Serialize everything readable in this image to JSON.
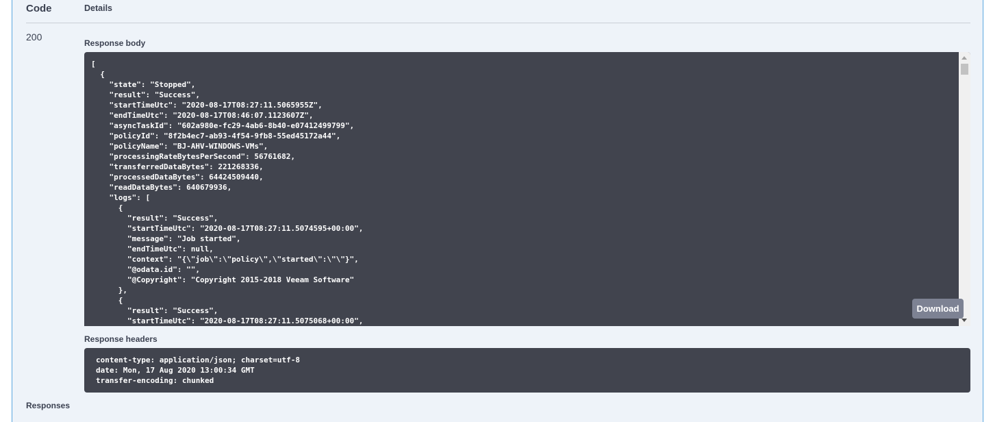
{
  "table": {
    "code_header": "Code",
    "details_header": "Details"
  },
  "response": {
    "status_code": "200",
    "body_label": "Response body",
    "body_lines": [
      "[",
      "  {",
      "    \"state\": \"Stopped\",",
      "    \"result\": \"Success\",",
      "    \"startTimeUtc\": \"2020-08-17T08:27:11.5065955Z\",",
      "    \"endTimeUtc\": \"2020-08-17T08:46:07.1123607Z\",",
      "    \"asyncTaskId\": \"602a980e-fc29-4ab6-8b40-e07412499799\",",
      "    \"policyId\": \"8f2b4ec7-ab93-4f54-9fb8-55ed45172a44\",",
      "    \"policyName\": \"BJ-AHV-WINDOWS-VMs\",",
      "    \"processingRateBytesPerSecond\": 56761682,",
      "    \"transferredDataBytes\": 221268336,",
      "    \"processedDataBytes\": 64424509440,",
      "    \"readDataBytes\": 640679936,",
      "    \"logs\": [",
      "      {",
      "        \"result\": \"Success\",",
      "        \"startTimeUtc\": \"2020-08-17T08:27:11.5074595+00:00\",",
      "        \"message\": \"Job started\",",
      "        \"endTimeUtc\": null,",
      "        \"context\": \"{\\\"job\\\":\\\"policy\\\",\\\"started\\\":\\\"\\\"}\",",
      "        \"@odata.id\": \"\",",
      "        \"@Copyright\": \"Copyright 2015-2018 Veeam Software\"",
      "      },",
      "      {",
      "        \"result\": \"Success\",",
      "        \"startTimeUtc\": \"2020-08-17T08:27:11.5075068+00:00\","
    ],
    "download_label": "Download",
    "headers_label": "Response headers",
    "headers_lines": [
      "content-type: application/json; charset=utf-8",
      "date: Mon, 17 Aug 2020 13:00:34 GMT",
      "transfer-encoding: chunked"
    ]
  },
  "footer": {
    "responses_label": "Responses"
  }
}
